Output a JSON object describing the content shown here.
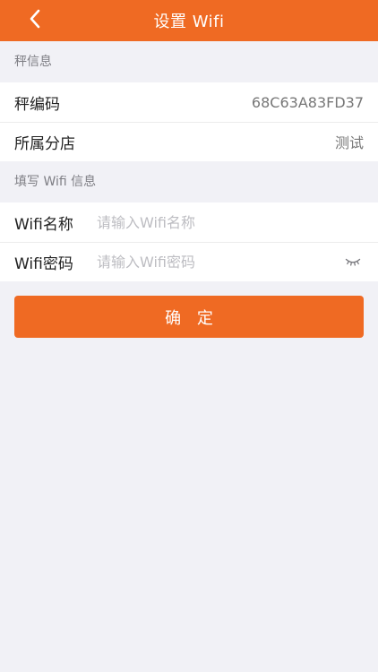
{
  "header": {
    "title": "设置 Wifi",
    "back_icon": "chevron-left-icon"
  },
  "scale_info": {
    "section_label": "秤信息",
    "rows": [
      {
        "label": "秤编码",
        "value": "68C63A83FD37"
      },
      {
        "label": "所属分店",
        "value": "测试"
      }
    ]
  },
  "wifi_info": {
    "section_label": "填写 Wifi 信息",
    "name": {
      "label": "Wifi名称",
      "placeholder": "请输入Wifi名称",
      "value": ""
    },
    "password": {
      "label": "Wifi密码",
      "placeholder": "请输入Wifi密码",
      "value": "",
      "toggle_icon": "eye-closed-icon"
    }
  },
  "actions": {
    "confirm_label": "确 定"
  },
  "colors": {
    "accent": "#ef6a23",
    "background": "#f1f1f6",
    "secondary_text": "#7e7e84",
    "placeholder": "#bdbdc2"
  }
}
